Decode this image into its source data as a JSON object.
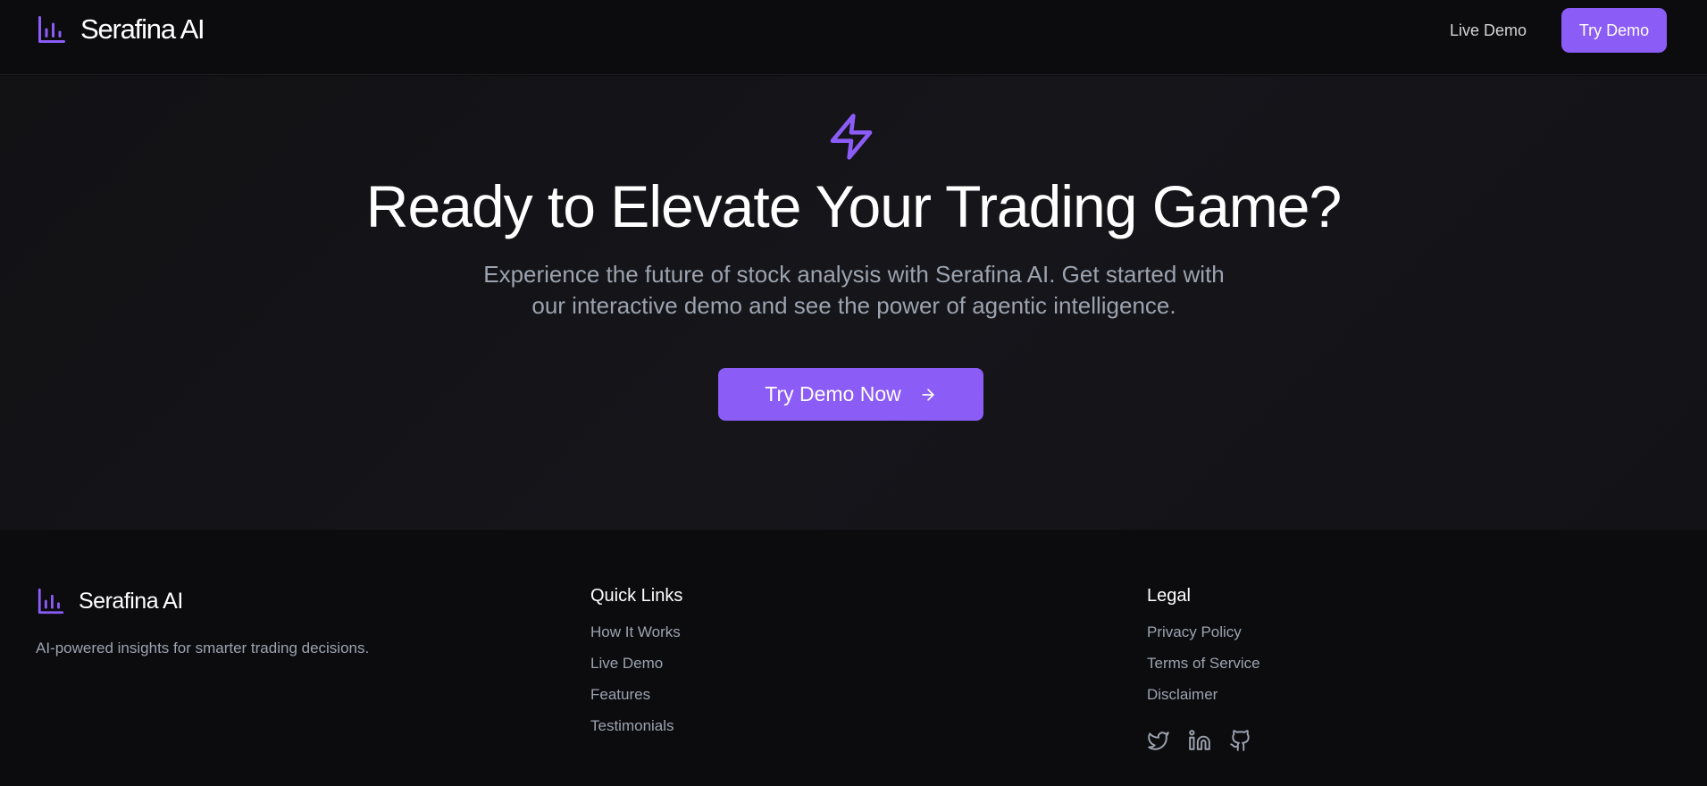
{
  "colors": {
    "accent": "#8b5cf6",
    "background": "#0d0d10",
    "muted_text": "#9ca3af"
  },
  "nav": {
    "logo_icon": "bar-chart-icon",
    "brand": "Serafina AI",
    "live_demo": "Live Demo",
    "try_demo": "Try Demo"
  },
  "hero": {
    "icon": "lightning-bolt-icon",
    "title": "Ready to Elevate Your Trading Game?",
    "subtitle": "Experience the future of stock analysis with Serafina AI. Get started with our interactive demo and see the power of agentic intelligence.",
    "cta": "Try Demo Now",
    "cta_icon": "arrow-right-icon"
  },
  "footer": {
    "brand": "Serafina AI",
    "tagline": "AI-powered insights for smarter trading decisions.",
    "quick_links": {
      "heading": "Quick Links",
      "items": [
        "How It Works",
        "Live Demo",
        "Features",
        "Testimonials"
      ]
    },
    "legal": {
      "heading": "Legal",
      "items": [
        "Privacy Policy",
        "Terms of Service",
        "Disclaimer"
      ]
    },
    "socials": [
      "twitter-icon",
      "linkedin-icon",
      "github-icon"
    ]
  }
}
